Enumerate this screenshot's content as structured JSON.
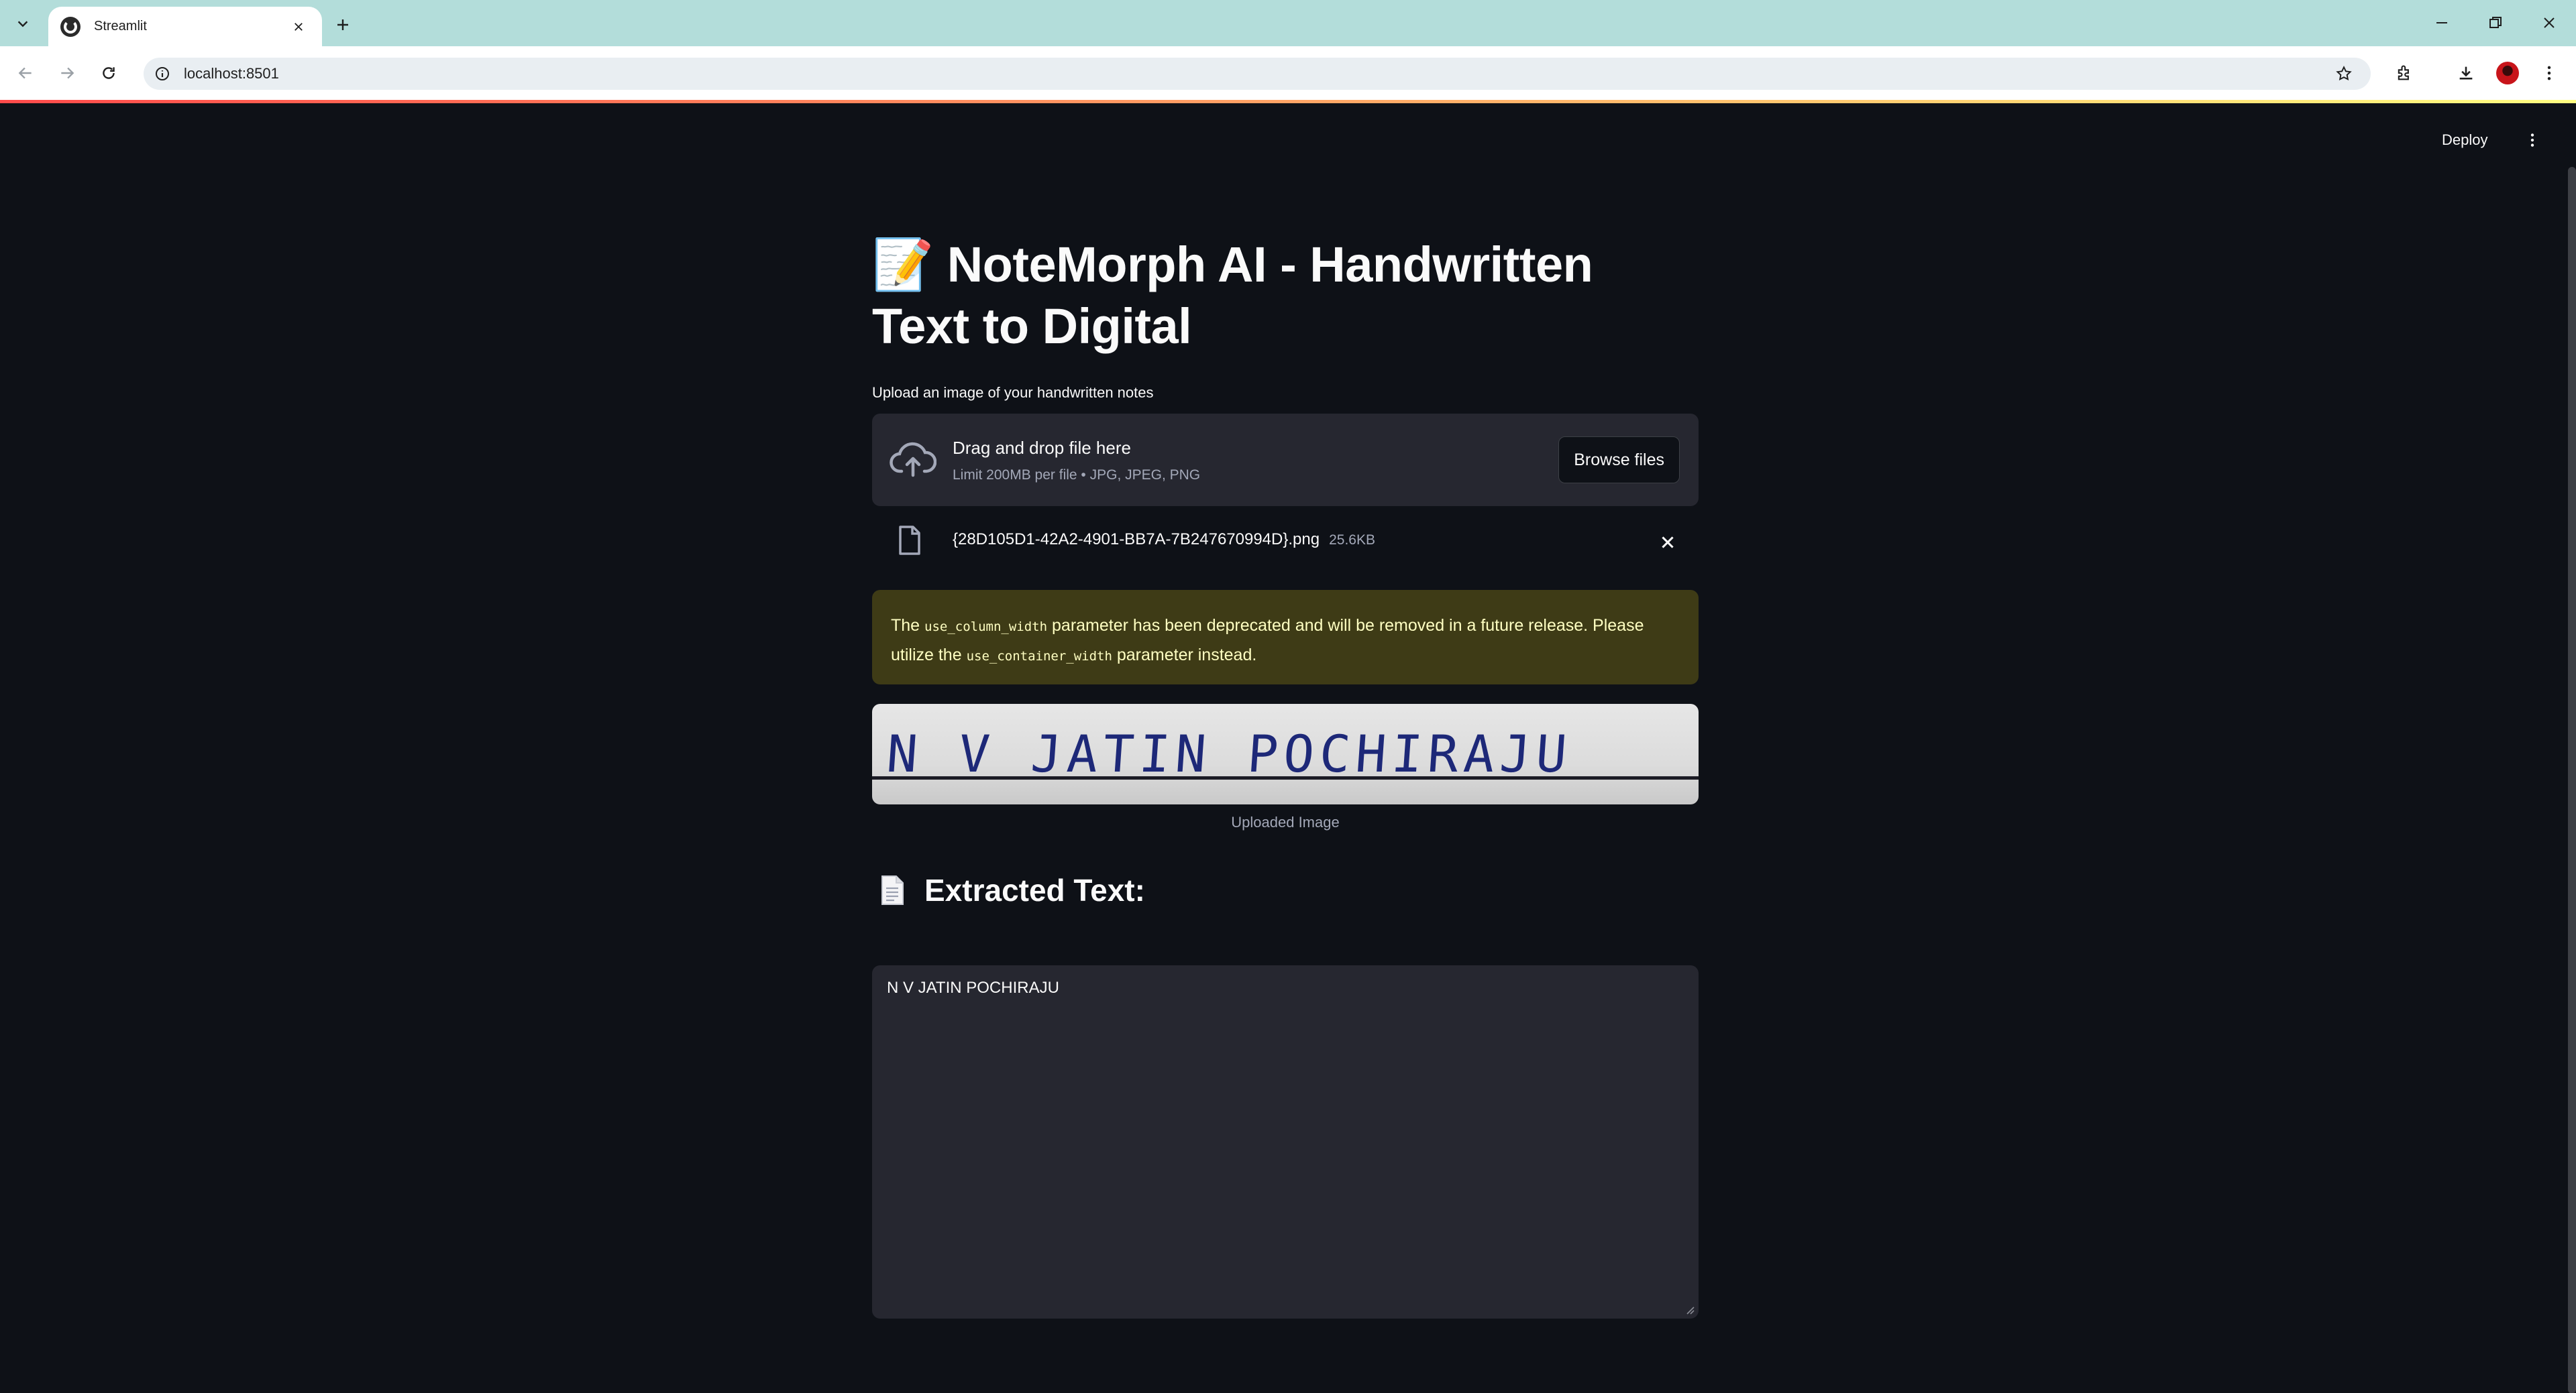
{
  "browser": {
    "tab_title": "Streamlit",
    "url": "localhost:8501"
  },
  "header": {
    "deploy_label": "Deploy"
  },
  "page": {
    "title_emoji": "📝",
    "title": "NoteMorph AI - Handwritten Text to Digital"
  },
  "uploader": {
    "label": "Upload an image of your handwritten notes",
    "drop_text": "Drag and drop file here",
    "limit_text": "Limit 200MB per file • JPG, JPEG, PNG",
    "browse_label": "Browse files",
    "file_name": "{28D105D1-42A2-4901-BB7A-7B247670994D}.png",
    "file_size": "25.6KB"
  },
  "warning": {
    "part1": "The ",
    "code1": "use_column_width",
    "part2": " parameter has been deprecated and will be removed in a future release. Please utilize the ",
    "code2": "use_container_width",
    "part3": " parameter instead."
  },
  "image": {
    "handwritten_text": "N V JATIN POCHIRAJU",
    "caption": "Uploaded Image"
  },
  "result": {
    "subheader": "Extracted Text:",
    "text": "N V JATIN POCHIRAJU"
  },
  "colors": {
    "app_bg": "#0e1117",
    "widget_bg": "#262730",
    "warning_bg": "#3e3b16",
    "warning_text": "#ffffc2",
    "tabstrip": "#b3ddda"
  },
  "icons": [
    "tab-search-icon",
    "close-icon",
    "plus-icon",
    "minimize-icon",
    "restore-icon",
    "back-icon",
    "forward-icon",
    "reload-icon",
    "info-icon",
    "star-icon",
    "extensions-icon",
    "download-icon",
    "kebab-menu-icon",
    "cloud-upload-icon",
    "file-icon",
    "document-icon"
  ]
}
